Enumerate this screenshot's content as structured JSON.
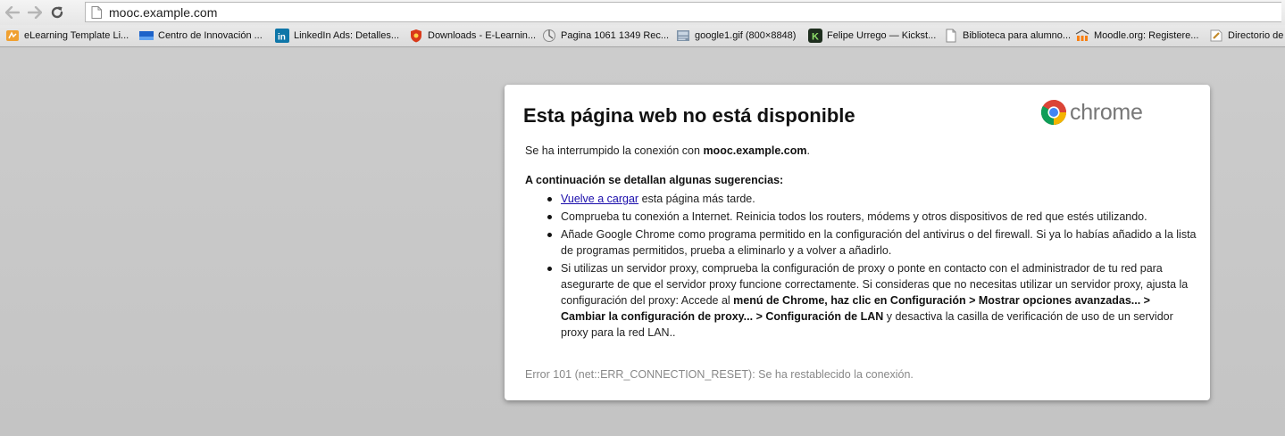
{
  "browser": {
    "url": "mooc.example.com"
  },
  "bookmarks": [
    {
      "label": "eLearning Template Li...",
      "icon": "elearning-favicon",
      "width": 150
    },
    {
      "label": "Centro de Innovación ...",
      "icon": "blue-square-favicon",
      "width": 152
    },
    {
      "label": "LinkedIn Ads: Detalles...",
      "icon": "linkedin-favicon",
      "width": 150
    },
    {
      "label": "Downloads - E-Learnin...",
      "icon": "shield-favicon",
      "width": 149
    },
    {
      "label": "Pagina 1061 1349 Rec...",
      "icon": "globe-favicon",
      "width": 150
    },
    {
      "label": "google1.gif (800×8848)",
      "icon": "image-favicon",
      "width": 148
    },
    {
      "label": "Felipe Urrego — Kickst...",
      "icon": "kickstarter-favicon",
      "width": 152
    },
    {
      "label": "Biblioteca para alumno...",
      "icon": "document-favicon",
      "width": 147
    },
    {
      "label": "Moodle.org: Registere...",
      "icon": "moodle-favicon",
      "width": 150
    },
    {
      "label": "Directorio de",
      "icon": "pen-favicon",
      "width": 100
    }
  ],
  "error": {
    "title": "Esta página web no está disponible",
    "logo_text": "chrome",
    "interrupted_prefix": "Se ha interrumpido la conexión con ",
    "interrupted_host": "mooc.example.com",
    "interrupted_suffix": ".",
    "suggestions_heading": "A continuación se detallan algunas sugerencias:",
    "s1_link": "Vuelve a cargar",
    "s1_rest": " esta página más tarde.",
    "s2": "Comprueba tu conexión a Internet. Reinicia todos los routers, módems y otros dispositivos de red que estés utilizando.",
    "s3": "Añade Google Chrome como programa permitido en la configuración del antivirus o del firewall. Si ya lo habías añadido a la lista de programas permitidos, prueba a eliminarlo y a volver a añadirlo.",
    "s4_a": "Si utilizas un servidor proxy, comprueba la configuración de proxy o ponte en contacto con el administrador de tu red para asegurarte de que el servidor proxy funcione correctamente. Si consideras que no necesitas utilizar un servidor proxy, ajusta la configuración del proxy: Accede al ",
    "s4_bold": "menú de Chrome, haz clic en Configuración > Mostrar opciones avanzadas... > Cambiar la configuración de proxy... > Configuración de LAN",
    "s4_b": " y desactiva la casilla de verificación de uso de un servidor proxy para la red LAN..",
    "code": "Error 101 (net::ERR_CONNECTION_RESET): Se ha restablecido la conexión."
  },
  "colors": {
    "link": "#1a0dab",
    "error_code": "#888888",
    "background": "#c8c8c8"
  }
}
